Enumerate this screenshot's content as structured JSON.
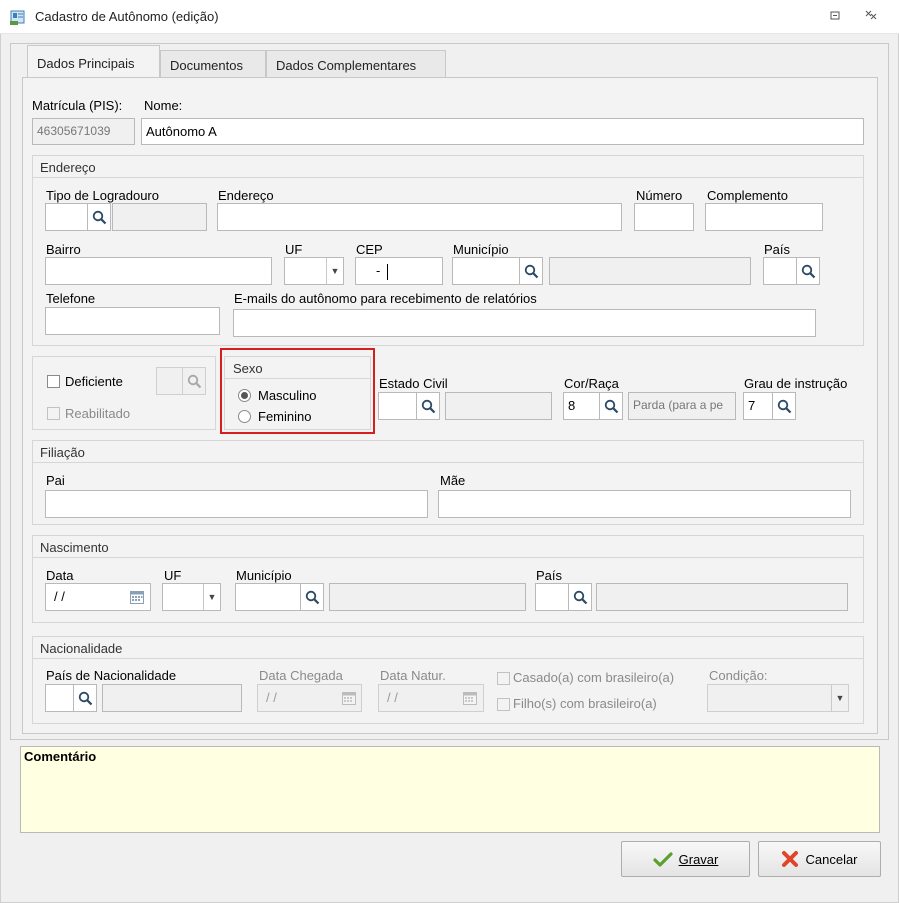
{
  "window": {
    "title": "Cadastro de Autônomo (edição)"
  },
  "tabs": [
    {
      "label": "Dados Principais"
    },
    {
      "label": "Documentos"
    },
    {
      "label": "Dados Complementares"
    }
  ],
  "main": {
    "pis_label": "Matrícula (PIS):",
    "pis_value": "46305671039",
    "nome_label": "Nome:",
    "nome_value": "Autônomo A"
  },
  "endereco": {
    "title": "Endereço",
    "tipo_logradouro_label": "Tipo de Logradouro",
    "endereco_label": "Endereço",
    "numero_label": "Número",
    "complemento_label": "Complemento",
    "bairro_label": "Bairro",
    "uf_label": "UF",
    "cep_label": "CEP",
    "cep_value": "-",
    "municipio_label": "Município",
    "pais_label": "País",
    "telefone_label": "Telefone",
    "emails_label": "E-mails do autônomo para recebimento de relatórios"
  },
  "pessoal": {
    "deficiente_label": "Deficiente",
    "reabilitado_label": "Reabilitado",
    "sexo_title": "Sexo",
    "masculino_label": "Masculino",
    "feminino_label": "Feminino",
    "sexo_selected": "Masculino",
    "estado_civil_label": "Estado Civil",
    "cor_raca_label": "Cor/Raça",
    "cor_raca_code": "8",
    "cor_raca_desc": "Parda (para a pe",
    "grau_label": "Grau de instrução",
    "grau_code": "7"
  },
  "filiacao": {
    "title": "Filiação",
    "pai_label": "Pai",
    "mae_label": "Mãe"
  },
  "nascimento": {
    "title": "Nascimento",
    "data_label": "Data",
    "data_value": " / /",
    "uf_label": "UF",
    "municipio_label": "Município",
    "pais_label": "País"
  },
  "nacionalidade": {
    "title": "Nacionalidade",
    "pais_label": "País de Nacionalidade",
    "data_chegada_label": "Data Chegada",
    "data_chegada_value": " / /",
    "data_natur_label": "Data Natur.",
    "data_natur_value": " / /",
    "casado_label": "Casado(a) com brasileiro(a)",
    "filhos_label": "Filho(s) com brasileiro(a)",
    "condicao_label": "Condição:"
  },
  "comentario": {
    "label": "Comentário"
  },
  "buttons": {
    "gravar_label": "Gravar",
    "cancelar_label": "Cancelar"
  },
  "icons": {
    "app": "address-card-icon",
    "search": "magnifier-icon",
    "calendar": "calendar-icon",
    "check": "green-check-icon",
    "cancel": "red-x-icon"
  },
  "colors": {
    "highlight_border": "#d41f1f",
    "comment_bg": "#ffffe1",
    "check_green": "#5aa02c",
    "cancel_red": "#e0452b"
  }
}
